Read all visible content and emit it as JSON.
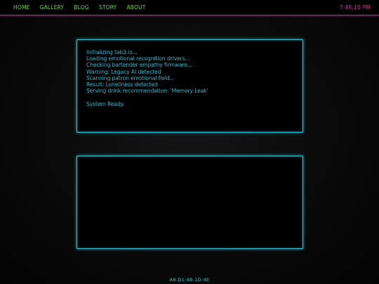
{
  "nav": {
    "links": [
      {
        "label": "HOME"
      },
      {
        "label": "GALLERY"
      },
      {
        "label": "BLOG"
      },
      {
        "label": "STORY"
      },
      {
        "label": "ABOUT"
      }
    ],
    "clock": "7:48:10 PM"
  },
  "terminal": {
    "lines": [
      "Initializing tab3.io...",
      "Loading emotional recognition drivers...",
      "Checking bartender empathy firmware...",
      "Warning: Legacy AI detected",
      "Scanning patron emotional field...",
      "Result: Loneliness detected",
      "Serving drink recommendation: 'Memory Leak'",
      "",
      "System Ready."
    ]
  },
  "output": {
    "text": ""
  },
  "footer": {
    "text": "A8:D1:4B:1D:4E"
  },
  "colors": {
    "nav_link": "#5ee01a",
    "clock": "#e0299f",
    "accent_border": "#2bc7d8",
    "terminal_text": "#25b9d1",
    "nav_border": "#c21ea4"
  }
}
